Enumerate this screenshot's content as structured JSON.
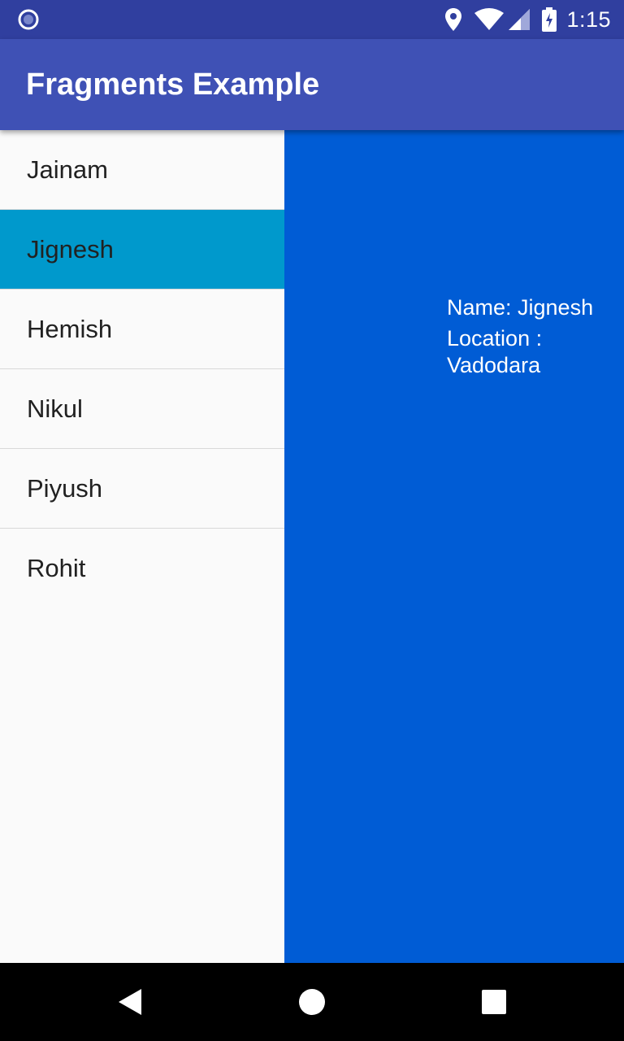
{
  "status_bar": {
    "time": "1:15",
    "left_icon": "notification-dot-icon",
    "icons": [
      "location-icon",
      "wifi-icon",
      "cell-signal-icon",
      "battery-charging-icon"
    ]
  },
  "app_bar": {
    "title": "Fragments Example",
    "color": "#3f51b5"
  },
  "list": {
    "items": [
      {
        "label": "Jainam"
      },
      {
        "label": "Jignesh"
      },
      {
        "label": "Hemish"
      },
      {
        "label": "Nikul"
      },
      {
        "label": "Piyush"
      },
      {
        "label": "Rohit"
      }
    ],
    "selected_label": "Jignesh",
    "selected_color": "#0099cc"
  },
  "detail": {
    "name_line": "Name: Jignesh",
    "location_line_1": "Location :",
    "location_line_2": "Vadodara",
    "background": "#005cd5"
  },
  "nav_bar": {
    "icons": [
      "back-icon",
      "home-icon",
      "recents-icon"
    ]
  }
}
